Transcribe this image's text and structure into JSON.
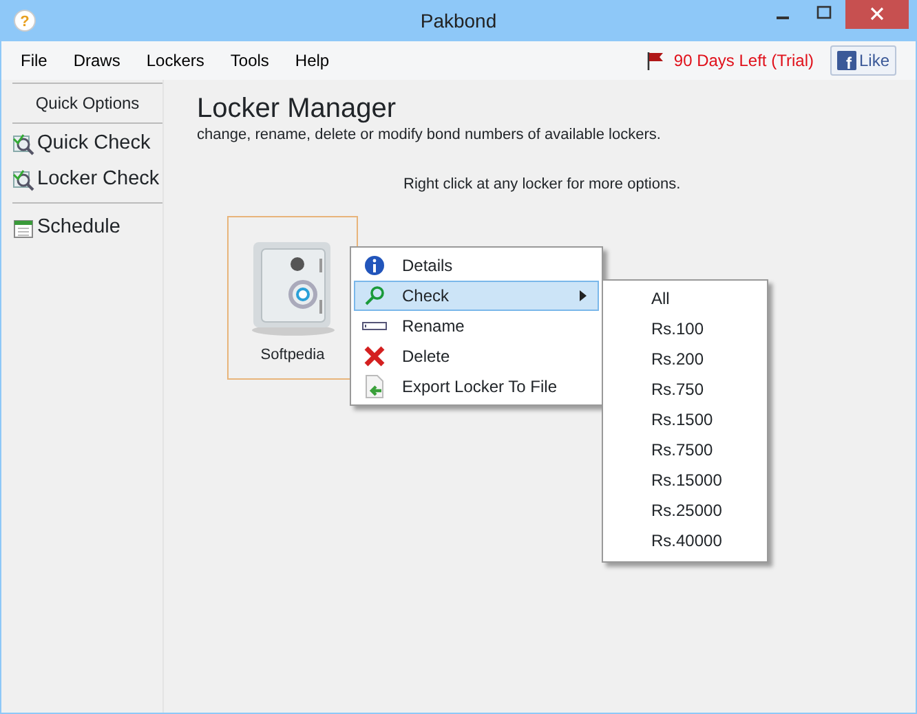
{
  "window": {
    "title": "Pakbond",
    "icon": "?"
  },
  "menu_bar": [
    "File",
    "Draws",
    "Lockers",
    "Tools",
    "Help"
  ],
  "trial": {
    "text": "90 Days Left (Trial)"
  },
  "like_button": {
    "label": "Like",
    "icon": "f"
  },
  "sidebar": {
    "header": "Quick Options",
    "items": [
      {
        "label": "Quick Check",
        "kind": "check",
        "divider_after": false
      },
      {
        "label": "Locker Check",
        "kind": "check",
        "divider_after": true
      },
      {
        "label": "Schedule",
        "kind": "calendar",
        "divider_after": false
      }
    ]
  },
  "page": {
    "title": "Locker Manager",
    "subtitle": "change, rename, delete or modify bond numbers of available lockers.",
    "hint": "Right click at any locker for more options."
  },
  "lockers": [
    {
      "name": "Softpedia",
      "selected": true
    }
  ],
  "context_menu": [
    {
      "label": "Details",
      "kind": "info",
      "selected": false,
      "submenu": false
    },
    {
      "label": "Check",
      "kind": "search",
      "selected": true,
      "submenu": true
    },
    {
      "label": "Rename",
      "kind": "rename",
      "selected": false,
      "submenu": false
    },
    {
      "label": "Delete",
      "kind": "delete",
      "selected": false,
      "submenu": false
    },
    {
      "label": "Export Locker To File",
      "kind": "export",
      "selected": false,
      "submenu": false
    }
  ],
  "submenu": [
    "All",
    "Rs.100",
    "Rs.200",
    "Rs.750",
    "Rs.1500",
    "Rs.7500",
    "Rs.15000",
    "Rs.25000",
    "Rs.40000"
  ]
}
